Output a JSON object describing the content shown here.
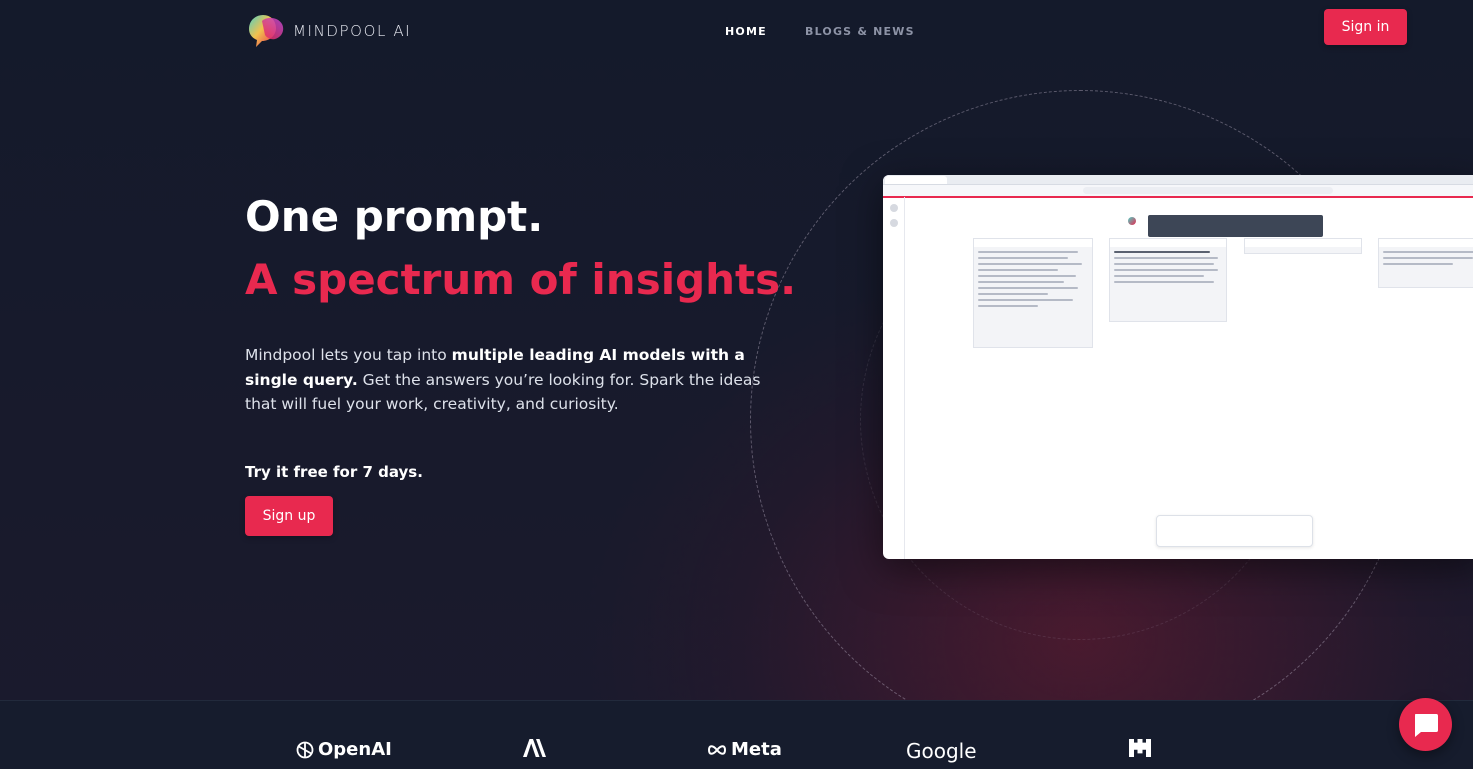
{
  "brand": {
    "name": "MINDPOOL AI",
    "logo_icon": "speech-bubble-gradient-logo"
  },
  "nav": {
    "links": [
      {
        "label": "HOME",
        "active": true
      },
      {
        "label": "BLOGS & NEWS",
        "active": false
      }
    ],
    "signin_label": "Sign in"
  },
  "hero": {
    "title": "One prompt.",
    "subtitle": "A spectrum of insights.",
    "description_prefix": "Mindpool lets you tap into ",
    "description_bold": "multiple leading AI models with a single query.",
    "description_suffix": " Get the answers you’re looking for. Spark the ideas that will fuel your work, creativity, and curiosity.",
    "trial_text": "Try it free for 7 days.",
    "signup_label": "Sign up"
  },
  "partners": [
    {
      "name": "OpenAI",
      "icon": "openai-knot-icon"
    },
    {
      "name": "",
      "icon": "anthropic-icon"
    },
    {
      "name": "Meta",
      "icon": "meta-infinity-icon"
    },
    {
      "name": "Google",
      "icon": ""
    },
    {
      "name": "",
      "icon": "mistral-icon"
    }
  ],
  "chat_widget": {
    "icon": "chat-icon"
  },
  "colors": {
    "accent": "#e8294f",
    "background": "#161a2b"
  }
}
